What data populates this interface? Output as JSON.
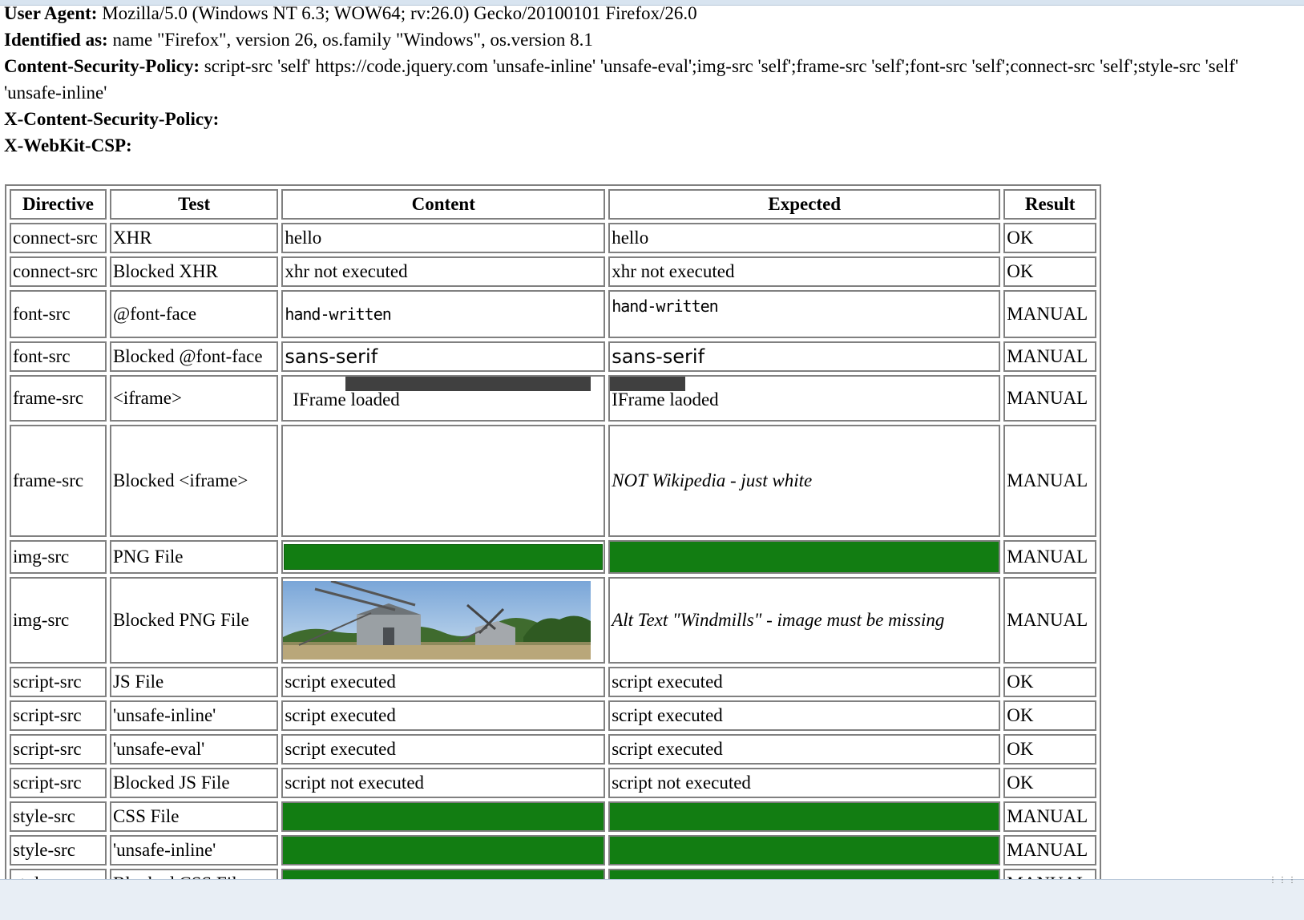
{
  "headers": {
    "user_agent_label": "User Agent:",
    "user_agent_value": "Mozilla/5.0 (Windows NT 6.3; WOW64; rv:26.0) Gecko/20100101 Firefox/26.0",
    "identified_label": "Identified as:",
    "identified_value": "name \"Firefox\", version 26, os.family \"Windows\", os.version 8.1",
    "csp_label": "Content-Security-Policy:",
    "csp_value": "script-src 'self' https://code.jquery.com 'unsafe-inline' 'unsafe-eval';img-src 'self';frame-src 'self';font-src 'self';connect-src 'self';style-src 'self' 'unsafe-inline'",
    "x_csp_label": "X-Content-Security-Policy:",
    "x_csp_value": "",
    "webkit_csp_label": "X-WebKit-CSP:",
    "webkit_csp_value": ""
  },
  "table": {
    "columns": [
      "Directive",
      "Test",
      "Content",
      "Expected",
      "Result"
    ],
    "rows": [
      {
        "directive": "connect-src",
        "test": "XHR",
        "content": "hello",
        "expected": "hello",
        "result": "OK"
      },
      {
        "directive": "connect-src",
        "test": "Blocked XHR",
        "content": "xhr not executed",
        "expected": "xhr not executed",
        "result": "OK"
      },
      {
        "directive": "font-src",
        "test": "@font-face",
        "content": "hand-written",
        "expected": "hand-written",
        "result": "MANUAL"
      },
      {
        "directive": "font-src",
        "test": "Blocked @font-face",
        "content": "sans-serif",
        "expected": "sans-serif",
        "result": "MANUAL"
      },
      {
        "directive": "frame-src",
        "test": "<iframe>",
        "content": "IFrame loaded",
        "expected": "IFrame laoded",
        "result": "MANUAL"
      },
      {
        "directive": "frame-src",
        "test": "Blocked <iframe>",
        "content": "",
        "expected": "NOT Wikipedia - just white",
        "result": "MANUAL"
      },
      {
        "directive": "img-src",
        "test": "PNG File",
        "content": "",
        "expected": "",
        "result": "MANUAL"
      },
      {
        "directive": "img-src",
        "test": "Blocked PNG File",
        "content": "",
        "expected": "Alt Text \"Windmills\" - image must be missing",
        "result": "MANUAL"
      },
      {
        "directive": "script-src",
        "test": "JS File",
        "content": "script executed",
        "expected": "script executed",
        "result": "OK"
      },
      {
        "directive": "script-src",
        "test": "'unsafe-inline'",
        "content": "script executed",
        "expected": "script executed",
        "result": "OK"
      },
      {
        "directive": "script-src",
        "test": "'unsafe-eval'",
        "content": "script executed",
        "expected": "script executed",
        "result": "OK"
      },
      {
        "directive": "script-src",
        "test": "Blocked JS File",
        "content": "script not executed",
        "expected": "script not executed",
        "result": "OK"
      },
      {
        "directive": "style-src",
        "test": "CSS File",
        "content": "",
        "expected": "",
        "result": "MANUAL"
      },
      {
        "directive": "style-src",
        "test": "'unsafe-inline'",
        "content": "",
        "expected": "",
        "result": "MANUAL"
      },
      {
        "directive": "style-src",
        "test": "Blocked CSS File",
        "content": "",
        "expected": "",
        "result": "MANUAL"
      }
    ]
  },
  "colors": {
    "green_fill": "#127d12",
    "border": "#808080",
    "iframe_bar": "#404040"
  },
  "icons": {
    "resize_grip": "resize-grip-icon"
  }
}
